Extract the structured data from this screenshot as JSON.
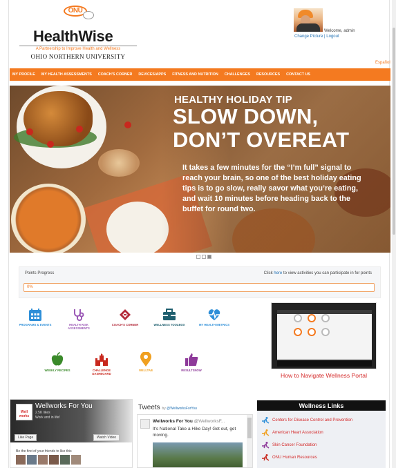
{
  "brand": {
    "badge": "ONU",
    "title": "HealthWise",
    "tagline": "A Partnership to Improve Health and Wellness",
    "university": "OHIO NORTHERN UNIVERSITY",
    "accent": "#f47a20"
  },
  "account": {
    "welcome": "Welcome, admin",
    "change_picture": "Change Picture",
    "separator": "|",
    "logout": "Logout",
    "language": "Español"
  },
  "nav": {
    "items": [
      "MY PROFILE",
      "MY HEALTH ASSESSMENTS",
      "COACH'S CORNER",
      "DEVICES/APPS",
      "FITNESS AND NUTRITION",
      "CHALLENGES",
      "RESOURCES",
      "CONTACT US"
    ]
  },
  "hero": {
    "label": "HEALTHY HOLIDAY TIP",
    "headline_1": "SLOW DOWN,",
    "headline_2": "DON’T OVEREAT",
    "body": "It takes a few minutes for the “I’m full” signal to reach your brain, so one of the best holiday eating tips is to go slow, really savor what you’re eating, and wait 10 minutes before heading back to the buffet for round two.",
    "slides": 3,
    "active_slide": 3
  },
  "points": {
    "title": "Points Progress",
    "note_prefix": "Click",
    "note_link": "here",
    "note_suffix": "to view activities you can participate in for points",
    "percent_label": "0%",
    "progress": 0
  },
  "tiles": [
    {
      "label": "PROGRAMS & EVENTS",
      "icon": "calendar-icon",
      "color": "#2e8fd8"
    },
    {
      "label": "HEALTH RISK ASSESSMENTS",
      "icon": "stethoscope-icon",
      "color": "#9b59b6"
    },
    {
      "label": "COACH'S CORNER",
      "icon": "clipboard-icon",
      "color": "#b32a3a"
    },
    {
      "label": "WELLNESS TOOLBOX",
      "icon": "toolbox-icon",
      "color": "#1f5f6f"
    },
    {
      "label": "MY HEALTH METRICS",
      "icon": "heart-pulse-icon",
      "color": "#2e8fd8"
    },
    {
      "label": "WEEKLY RECIPES",
      "icon": "apple-icon",
      "color": "#3a8a2a"
    },
    {
      "label": "CHALLENGE DASHBOARD",
      "icon": "castle-icon",
      "color": "#c8281e"
    },
    {
      "label": "WELLTAB",
      "icon": "map-pin-icon",
      "color": "#f0a020"
    },
    {
      "label": "RESULTSNOW",
      "icon": "thumbs-up-icon",
      "color": "#8e3a9a"
    }
  ],
  "video": {
    "caption": "How to Navigate Wellness Portal"
  },
  "facebook": {
    "page_name": "Wellworks For You",
    "logo_text": "Well works",
    "sub": "2.5K likes",
    "sub2": "Work and in life!",
    "like_button": "Like Page",
    "watch_button": "Watch Video",
    "friends_note": "Be the first of your friends to like this"
  },
  "tweets": {
    "title": "Tweets",
    "by_prefix": "by",
    "handle_link": "@WellworksForYou",
    "author": "Wellworks For You",
    "author_handle": "@WellworksF...",
    "text": "It's National Take a Hike Day! Get out, get moving."
  },
  "wellness_links": {
    "title": "Wellness Links",
    "items": [
      "Centers for Disease Control and Prevention",
      "American Heart Association",
      "Skin Cancer Foundation",
      "ONU Human Resources"
    ],
    "colors": [
      "#2e8fd8",
      "#f0a020",
      "#8e3a9a",
      "#c8281e"
    ]
  }
}
